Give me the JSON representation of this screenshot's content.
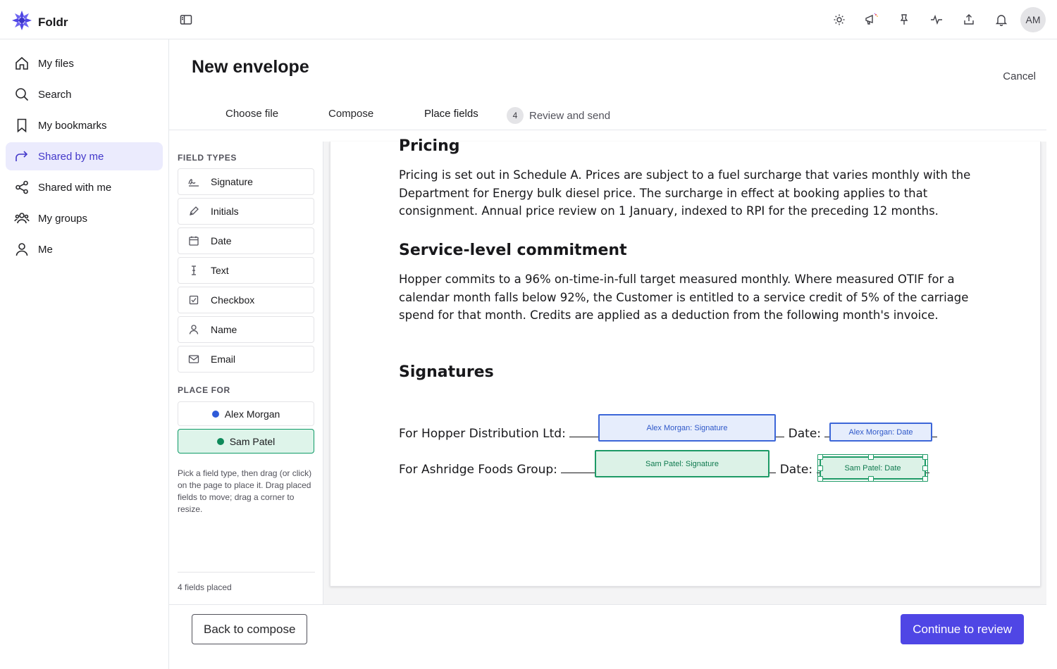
{
  "app": {
    "name": "Foldr",
    "user_initials": "AM"
  },
  "topbar": {
    "icons": [
      "sun-icon",
      "megaphone-icon",
      "pin-icon",
      "activity-icon",
      "share-icon",
      "bell-icon"
    ]
  },
  "sidebar": {
    "items": [
      {
        "label": "My files",
        "icon": "home-icon",
        "active": false
      },
      {
        "label": "Search",
        "icon": "search-icon",
        "active": false
      },
      {
        "label": "My bookmarks",
        "icon": "bookmark-icon",
        "active": false
      },
      {
        "label": "Shared by me",
        "icon": "share-arrow-icon",
        "active": true
      },
      {
        "label": "Shared with me",
        "icon": "share-nodes-icon",
        "active": false
      },
      {
        "label": "My groups",
        "icon": "group-icon",
        "active": false
      },
      {
        "label": "Me",
        "icon": "user-icon",
        "active": false
      }
    ]
  },
  "page": {
    "title": "New envelope",
    "cancel_label": "Cancel"
  },
  "steps": [
    {
      "label": "Choose file",
      "state": "done"
    },
    {
      "label": "Compose",
      "state": "done"
    },
    {
      "label": "Place fields",
      "state": "current"
    },
    {
      "number": "4",
      "label": "Review and send",
      "state": "upcoming"
    }
  ],
  "panel": {
    "field_types_label": "FIELD TYPES",
    "field_types": [
      {
        "label": "Signature",
        "icon": "signature-icon"
      },
      {
        "label": "Initials",
        "icon": "pen-icon"
      },
      {
        "label": "Date",
        "icon": "calendar-icon"
      },
      {
        "label": "Text",
        "icon": "text-cursor-icon"
      },
      {
        "label": "Checkbox",
        "icon": "checkbox-icon"
      },
      {
        "label": "Name",
        "icon": "person-icon"
      },
      {
        "label": "Email",
        "icon": "mail-icon"
      }
    ],
    "place_for_label": "PLACE FOR",
    "recipients": [
      {
        "name": "Alex Morgan",
        "color": "#2f5bd8",
        "active": false
      },
      {
        "name": "Sam Patel",
        "color": "#0e8a5a",
        "active": true
      }
    ],
    "hint": "Pick a field type, then drag (or click) on the page to place it. Drag placed fields to move; drag a corner to resize.",
    "footer": "4 fields placed"
  },
  "document": {
    "sections": [
      {
        "heading": "Pricing",
        "body": "Pricing is set out in Schedule A. Prices are subject to a fuel surcharge that varies monthly with the Department for Energy bulk diesel price. The surcharge in effect at booking applies to that consignment. Annual price review on 1 January, indexed to RPI for the preceding 12 months."
      },
      {
        "heading": "Service-level commitment",
        "body": "Hopper commits to a 96% on-time-in-full target measured monthly. Where measured OTIF for a calendar month falls below 92%, the Customer is entitled to a service credit of 5% of the carriage spend for that month. Credits are applied as a deduction from the following month's invoice."
      },
      {
        "heading": "Signatures"
      }
    ],
    "signature_lines": [
      {
        "party": "For Hopper Distribution Ltd:",
        "date_label": "Date:"
      },
      {
        "party": "For Ashridge Foods Group:",
        "date_label": "Date:"
      }
    ],
    "placed_fields": [
      {
        "label": "Alex Morgan: Signature",
        "recipient": "Alex Morgan"
      },
      {
        "label": "Alex Morgan: Date",
        "recipient": "Alex Morgan"
      },
      {
        "label": "Sam Patel: Signature",
        "recipient": "Sam Patel"
      },
      {
        "label": "Sam Patel: Date",
        "recipient": "Sam Patel",
        "selected": true
      }
    ]
  },
  "footer": {
    "back_label": "Back to compose",
    "next_label": "Continue to review"
  },
  "colors": {
    "accent": "#4f46e5",
    "alex": "#2f5bd8",
    "sam": "#0e8a5a",
    "active_nav_bg": "#ebebfd"
  }
}
